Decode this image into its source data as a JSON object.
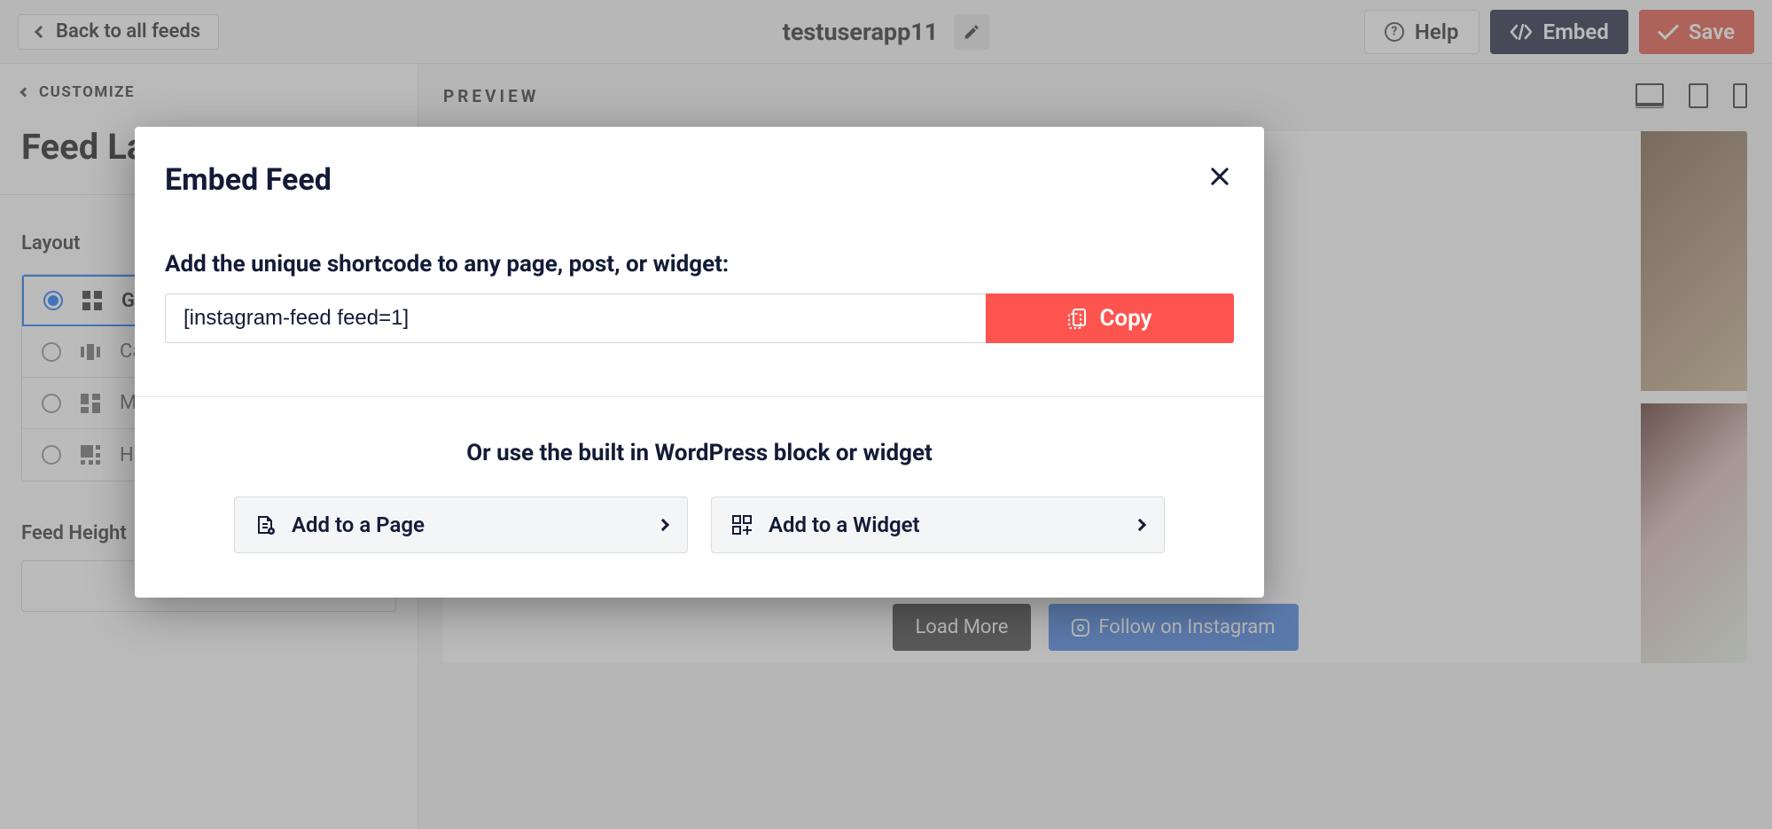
{
  "topbar": {
    "back_label": "Back to all feeds",
    "title": "testuserapp11",
    "help_label": "Help",
    "embed_label": "Embed",
    "save_label": "Save"
  },
  "sidebar": {
    "customize_label": "CUSTOMIZE",
    "panel_title": "Feed Layout",
    "layout_label": "Layout",
    "layouts": [
      {
        "label": "Grid"
      },
      {
        "label": "Carousel"
      },
      {
        "label": "Masonry"
      },
      {
        "label": "Highlight"
      }
    ],
    "feed_height_label": "Feed Height",
    "feed_height_value": ""
  },
  "preview": {
    "label": "PREVIEW",
    "load_more": "Load More",
    "follow_label": "Follow on Instagram"
  },
  "modal": {
    "title": "Embed Feed",
    "sub1": "Add the unique shortcode to any page, post, or widget:",
    "shortcode": "[instagram-feed feed=1]",
    "copy_label": "Copy",
    "sub2": "Or use the built in WordPress block or widget",
    "add_page_label": "Add to a Page",
    "add_widget_label": "Add to a Widget"
  }
}
